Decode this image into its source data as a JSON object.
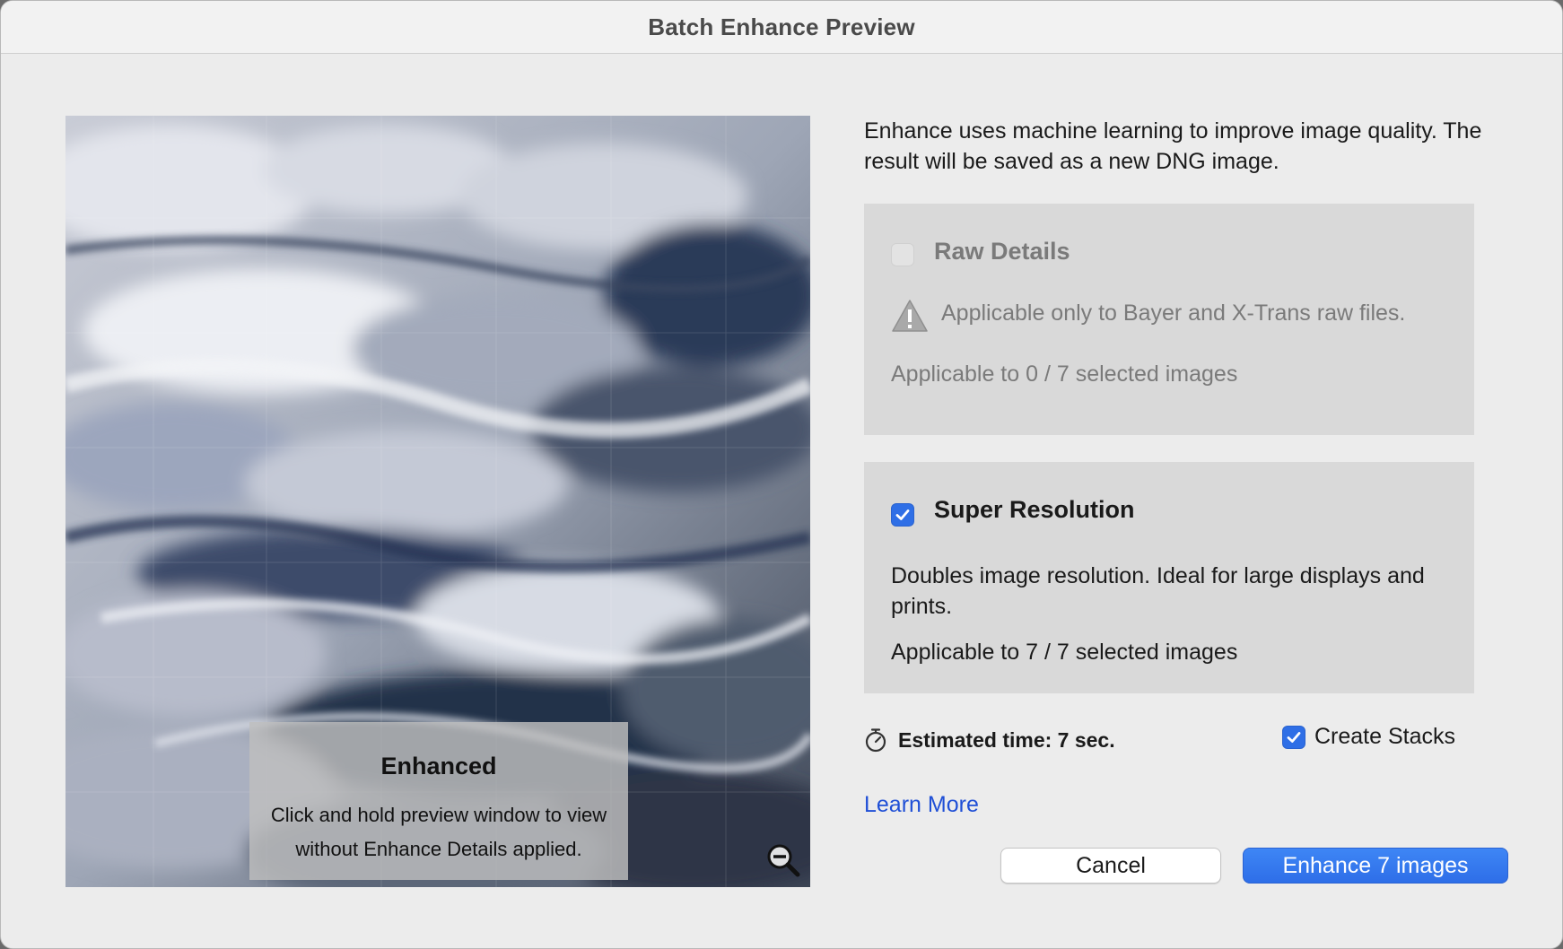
{
  "window": {
    "title": "Batch Enhance Preview"
  },
  "preview": {
    "overlay_title": "Enhanced",
    "overlay_text": "Click and hold preview window to view without Enhance Details applied.",
    "zoom_icon": "zoom-out-icon"
  },
  "intro": {
    "text": "Enhance uses machine learning to improve image quality. The result will be saved as a new DNG image."
  },
  "raw_details": {
    "label": "Raw Details",
    "checked": false,
    "enabled": false,
    "warning_icon": "warning-icon",
    "warning": "Applicable only to Bayer and X-Trans raw files.",
    "applicable": "Applicable to 0 / 7 selected images"
  },
  "super_resolution": {
    "label": "Super Resolution",
    "checked": true,
    "description": "Doubles image resolution. Ideal for large displays and prints.",
    "applicable": "Applicable to 7 / 7 selected images"
  },
  "estimate": {
    "icon": "timer-icon",
    "text": "Estimated time: 7 sec."
  },
  "create_stacks": {
    "label": "Create Stacks",
    "checked": true
  },
  "links": {
    "learn_more": "Learn More"
  },
  "buttons": {
    "cancel": "Cancel",
    "enhance": "Enhance 7 images"
  },
  "colors": {
    "accent": "#2f6fe6",
    "link": "#1f4fd6",
    "panel_bg": "#d9d9d9",
    "window_bg": "#ececec"
  }
}
